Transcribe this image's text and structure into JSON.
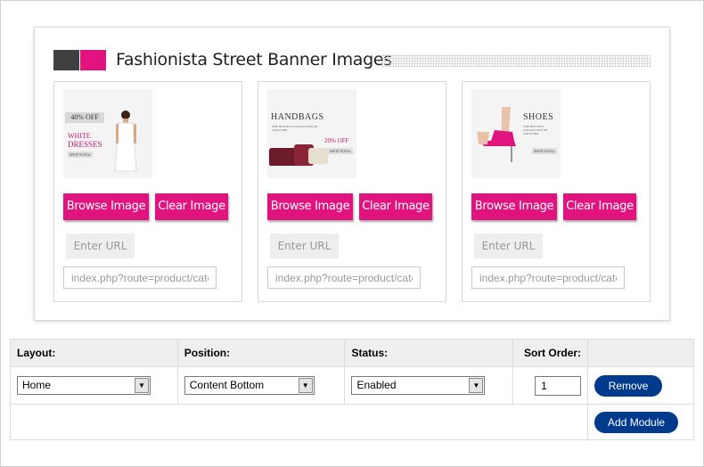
{
  "banner": {
    "title": "Fashionista Street Banner Images",
    "colors": {
      "accent": "#e0137f",
      "dark_square": "#404040"
    },
    "cards": [
      {
        "image_text": {
          "discount": "40% OFF",
          "line1": "WHITE",
          "line2": "DRESSES",
          "cta": "SHOP NOW ▸"
        },
        "browse_label": "Browse Image",
        "clear_label": "Clear Image",
        "url_label": "Enter URL",
        "url_value": "index.php?route=product/category"
      },
      {
        "image_text": {
          "headline": "HANDBAGS",
          "sub": "THE HOTTEST COLLECTION OF ARTWORK",
          "discount": "20% OFF",
          "cta": "SHOP NOW ▸"
        },
        "browse_label": "Browse Image",
        "clear_label": "Clear Image",
        "url_label": "Enter URL",
        "url_value": "index.php?route=product/category"
      },
      {
        "image_text": {
          "headline": "SHOES",
          "sub": "THE HOTTEST COLLECTION OF ARTWORK",
          "cta": "SHOP NOW ▸"
        },
        "browse_label": "Browse Image",
        "clear_label": "Clear Image",
        "url_label": "Enter URL",
        "url_value": "index.php?route=product/category"
      }
    ]
  },
  "modules": {
    "headers": {
      "layout": "Layout:",
      "position": "Position:",
      "status": "Status:",
      "sort_order": "Sort Order:"
    },
    "row": {
      "layout": "Home",
      "position": "Content Bottom",
      "status": "Enabled",
      "sort_order": "1",
      "remove_label": "Remove"
    },
    "add_label": "Add Module",
    "button_color": "#003a8c"
  }
}
